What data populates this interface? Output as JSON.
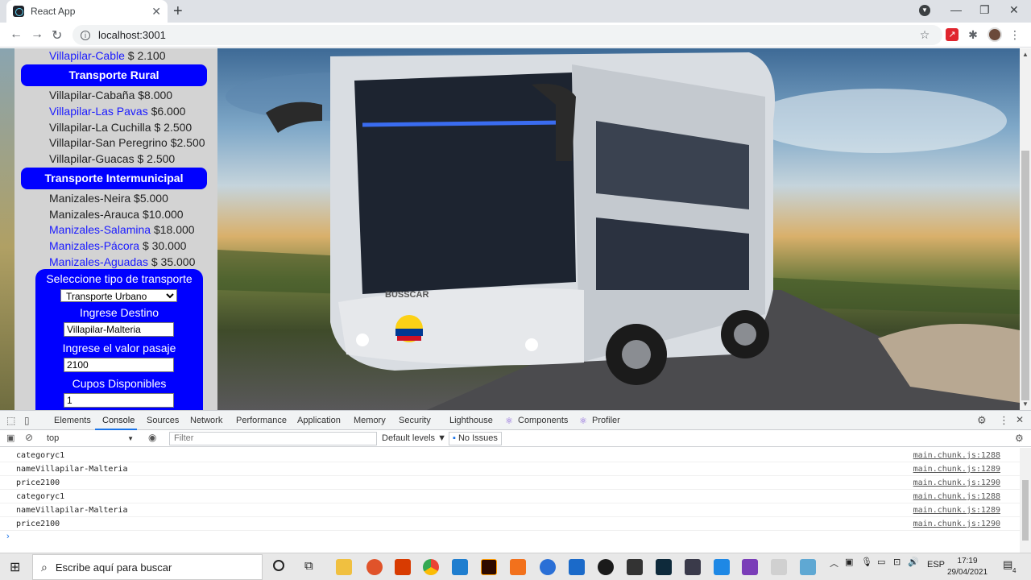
{
  "browser": {
    "tab_title": "React App",
    "url": "localhost:3001"
  },
  "sidebar": {
    "top_route": {
      "name": "Villapilar-Cable",
      "price": "$ 2.100"
    },
    "categories": [
      {
        "title": "Transporte Rural",
        "routes": [
          {
            "name": "Villapilar-Cabaña",
            "price": "$8.000",
            "link": false
          },
          {
            "name": "Villapilar-Las Pavas",
            "price": "$6.000",
            "link": true
          },
          {
            "name": "Villapilar-La Cuchilla",
            "price": "$ 2.500",
            "link": false
          },
          {
            "name": "Villapilar-San Peregrino",
            "price": "$2.500",
            "link": false
          },
          {
            "name": "Villapilar-Guacas",
            "price": "$ 2.500",
            "link": false
          }
        ]
      },
      {
        "title": "Transporte Intermunicipal",
        "routes": [
          {
            "name": "Manizales-Neira",
            "price": "$5.000",
            "link": false
          },
          {
            "name": "Manizales-Arauca",
            "price": "$10.000",
            "link": false
          },
          {
            "name": "Manizales-Salamina",
            "price": "$18.000",
            "link": true
          },
          {
            "name": "Manizales-Pácora",
            "price": "$ 30.000",
            "link": true
          },
          {
            "name": "Manizales-Aguadas",
            "price": "$ 35.000",
            "link": true
          }
        ]
      }
    ]
  },
  "form": {
    "type_label": "Seleccione tipo de transporte",
    "type_value": "Transporte Urbano",
    "destination_label": "Ingrese Destino",
    "destination_value": "Villapilar-Malteria",
    "price_label": "Ingrese el valor pasaje",
    "price_value": "2100",
    "seats_label": "Cupos Disponibles",
    "seats_value": "1"
  },
  "hero": {
    "bus_brand": "BUSSCAR"
  },
  "devtools": {
    "tabs": [
      "Elements",
      "Console",
      "Sources",
      "Network",
      "Performance",
      "Application",
      "Memory",
      "Security",
      "Lighthouse",
      "Components",
      "Profiler"
    ],
    "active_tab": "Console",
    "context": "top",
    "filter_placeholder": "Filter",
    "levels": "Default levels ▼",
    "issues": "No Issues",
    "logs": [
      {
        "msg": "categoryc1",
        "src": "main.chunk.js:1288"
      },
      {
        "msg": "nameVillapilar-Malteria",
        "src": "main.chunk.js:1289"
      },
      {
        "msg": "price2100",
        "src": "main.chunk.js:1290"
      },
      {
        "msg": "categoryc1",
        "src": "main.chunk.js:1288"
      },
      {
        "msg": "nameVillapilar-Malteria",
        "src": "main.chunk.js:1289"
      },
      {
        "msg": "price2100",
        "src": "main.chunk.js:1290"
      }
    ]
  },
  "taskbar": {
    "search_placeholder": "Escribe aquí para buscar",
    "language": "ESP",
    "time": "17:19",
    "date": "29/04/2021",
    "notifications": "4"
  }
}
